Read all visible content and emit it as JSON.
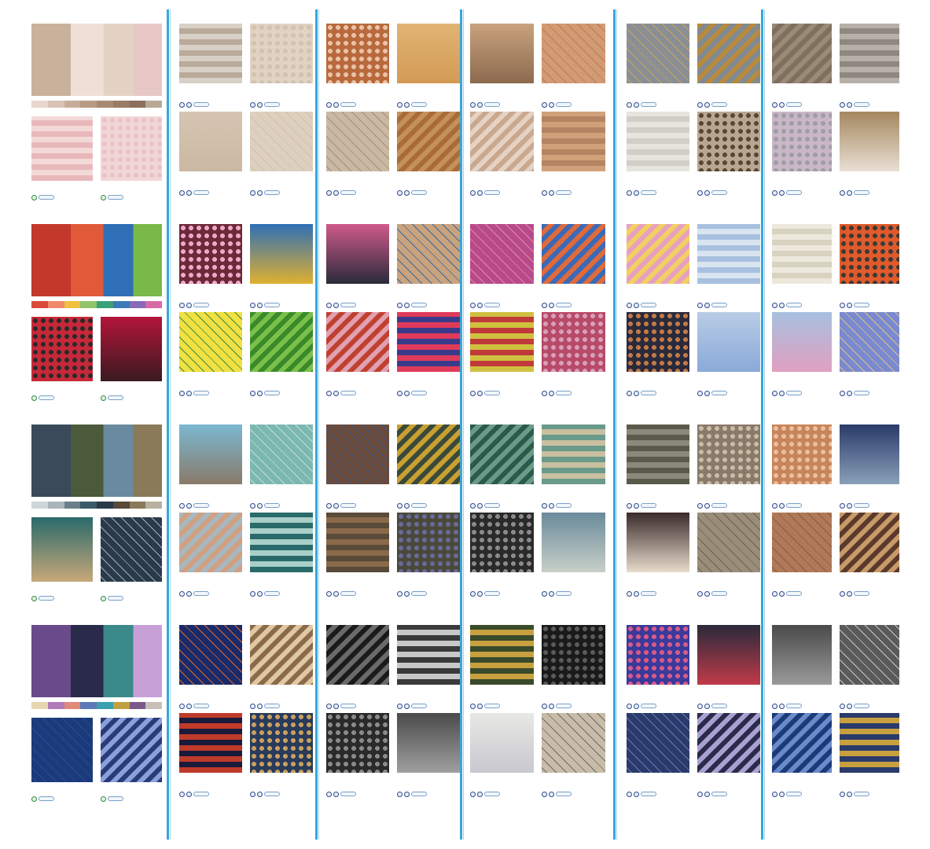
{
  "rows": [
    {
      "palette": [
        "#e8d7cc",
        "#d9c3b5",
        "#c7ad99",
        "#b89a84",
        "#a88a72",
        "#9a7c66",
        "#8d6f5b",
        "#b8a896"
      ],
      "cards": [
        {
          "a": [
            "#c9b29b",
            "#e4d3c4"
          ],
          "b": [
            "#f0dfd6",
            "#e7c8c6"
          ],
          "c": [
            "#e9b8bb",
            "#f3d9d8"
          ],
          "d": [
            "#f1d6d6",
            "#e8c2c4"
          ]
        },
        {
          "a": [
            "#d8d0c7",
            "#b9aa9a"
          ],
          "b": [
            "#e0d3c3",
            "#d2c2ae"
          ],
          "c": [
            "#d5c5b2",
            "#cbb8a3"
          ],
          "d": [
            "#ded0bf",
            "#cfbfab"
          ]
        },
        {
          "a": [
            "#b96a3d",
            "#e8c4a6"
          ],
          "b": [
            "#e1b472",
            "#d39a56"
          ],
          "c": [
            "#c9b8a3",
            "#a68e72"
          ],
          "d": [
            "#c4915a",
            "#a96c39"
          ]
        },
        {
          "a": [
            "#c9a27e",
            "#8c6a4e"
          ],
          "b": [
            "#d39b73",
            "#b87a55"
          ],
          "c": [
            "#c9a890",
            "#e6d2c2"
          ],
          "d": [
            "#d1a07a",
            "#b48462"
          ]
        },
        {
          "a": [
            "#8a8f95",
            "#c9a45a"
          ],
          "b": [
            "#b88a3c",
            "#7f8a94"
          ],
          "c": [
            "#e5e4dd",
            "#cfcfc7"
          ],
          "d": [
            "#b9a690",
            "#5a4636"
          ]
        },
        {
          "a": [
            "#9a8a78",
            "#7f6f5e"
          ],
          "b": [
            "#b7b0a8",
            "#8f8880"
          ],
          "c": [
            "#c9b7c6",
            "#9e9da8"
          ],
          "d": [
            "#a5875f",
            "#e8e0d4"
          ]
        }
      ]
    },
    {
      "palette": [
        "#d94a3a",
        "#f08a6a",
        "#f0c040",
        "#8fc46a",
        "#3aa07a",
        "#3a7ab8",
        "#8a6ab8",
        "#d86aa8"
      ],
      "cards": [
        {
          "a": [
            "#c2392b",
            "#2f6fb5"
          ],
          "b": [
            "#e05a3a",
            "#7ab84a"
          ],
          "c": [
            "#c7283a",
            "#2a2a2a"
          ],
          "d": [
            "#b3153a",
            "#3a1a20"
          ]
        },
        {
          "a": [
            "#6b2a3a",
            "#f0a8c8"
          ],
          "b": [
            "#2f6fb5",
            "#e0b030"
          ],
          "c": [
            "#f0e040",
            "#3a8a4a"
          ],
          "d": [
            "#3a8a2a",
            "#7ac04a"
          ]
        },
        {
          "a": [
            "#d05a8a",
            "#2a2a3a"
          ],
          "b": [
            "#c9a27e",
            "#3a6a9a"
          ],
          "c": [
            "#c04030",
            "#e0a0b0"
          ],
          "d": [
            "#e03a5a",
            "#3a3a8a"
          ]
        },
        {
          "a": [
            "#b84a8a",
            "#e08ab0"
          ],
          "b": [
            "#3a6ab8",
            "#e06a3a"
          ],
          "c": [
            "#d0c040",
            "#c03a3a"
          ],
          "d": [
            "#b84a6a",
            "#d8a0b8"
          ]
        },
        {
          "a": [
            "#e8a0c0",
            "#f0d060"
          ],
          "b": [
            "#a8c0e0",
            "#d8e4f0"
          ],
          "c": [
            "#2a2a3a",
            "#c07a4a"
          ],
          "d": [
            "#b8cce6",
            "#8aaad8"
          ]
        },
        {
          "a": [
            "#ece8dc",
            "#d8d2c0"
          ],
          "b": [
            "#e05a2a",
            "#3a3a3a"
          ],
          "c": [
            "#a8c0e0",
            "#e0a0c0"
          ],
          "d": [
            "#7a8ad0",
            "#e0c080"
          ]
        }
      ]
    },
    {
      "palette": [
        "#cfd6da",
        "#a9b4bb",
        "#6a7f8a",
        "#3a5a6a",
        "#2a3a4a",
        "#5a4a3a",
        "#8a7a5a",
        "#b8b0a0"
      ],
      "cards": [
        {
          "a": [
            "#3a4a5a",
            "#6a8aa0"
          ],
          "b": [
            "#4a5a3a",
            "#8a7a5a"
          ],
          "c": [
            "#2a6a6a",
            "#c8a87a"
          ],
          "d": [
            "#2a3a4a",
            "#9ab0b8"
          ]
        },
        {
          "a": [
            "#7ab8d0",
            "#8a7a6a"
          ],
          "b": [
            "#7ab8b0",
            "#c8dcd6"
          ],
          "c": [
            "#a8b8c0",
            "#d0a080"
          ],
          "d": [
            "#2a6a6a",
            "#a8d0c8"
          ]
        },
        {
          "a": [
            "#6a4a3a",
            "#3a5a8a"
          ],
          "b": [
            "#c9a030",
            "#3a4a3a"
          ],
          "c": [
            "#5a4a3a",
            "#8a6a4a"
          ],
          "d": [
            "#4a4a3a",
            "#6a6a9a"
          ]
        },
        {
          "a": [
            "#2a5a4a",
            "#6a9a8a"
          ],
          "b": [
            "#6a9a8a",
            "#c8c0a0"
          ],
          "c": [
            "#2a2a2a",
            "#8a8a8a"
          ],
          "d": [
            "#6a8a9a",
            "#c8d0c8"
          ]
        },
        {
          "a": [
            "#5a5a4a",
            "#8a8a7a"
          ],
          "b": [
            "#8a7a6a",
            "#c8bca8"
          ],
          "c": [
            "#3a2a2a",
            "#e8dccc"
          ],
          "d": [
            "#9a8e7a",
            "#6a6050"
          ]
        },
        {
          "a": [
            "#c8845a",
            "#e8c0a0"
          ],
          "b": [
            "#2a3a6a",
            "#8aa0b8"
          ],
          "c": [
            "#b07a5a",
            "#8a5a3a"
          ],
          "d": [
            "#c89a6a",
            "#5a3a2a"
          ]
        }
      ]
    },
    {
      "palette": [
        "#e8d6b0",
        "#b07ab8",
        "#e08a7a",
        "#5a7ab8",
        "#3aa0b0",
        "#c0a040",
        "#7a5a8a",
        "#c8c0b8"
      ],
      "cards": [
        {
          "a": [
            "#6a4a8a",
            "#3a8a8a"
          ],
          "b": [
            "#2a2a4a",
            "#c8a0d8"
          ],
          "c": [
            "#1a3a7a",
            "#2a4a9a"
          ],
          "d": [
            "#2a3a7a",
            "#8aa0d8"
          ]
        },
        {
          "a": [
            "#1a2a6a",
            "#e06a2a"
          ],
          "b": [
            "#8a6a4a",
            "#e0c8a0"
          ],
          "c": [
            "#c03a2a",
            "#1a1a3a"
          ],
          "d": [
            "#2a3a5a",
            "#c8a060"
          ]
        },
        {
          "a": [
            "#1a1a1a",
            "#6a6a6a"
          ],
          "b": [
            "#3a3a3a",
            "#c8c8c8"
          ],
          "c": [
            "#2a2a2a",
            "#8a8a8a"
          ],
          "d": [
            "#4a4a4a",
            "#a0a0a0"
          ]
        },
        {
          "a": [
            "#3a4a2a",
            "#c8a040"
          ],
          "b": [
            "#1a1a1a",
            "#5a5a5a"
          ],
          "c": [
            "#e8e8e4",
            "#c8c8d0"
          ],
          "d": [
            "#c8bca8",
            "#6a6a6a"
          ]
        },
        {
          "a": [
            "#3a3a9a",
            "#d85a8a"
          ],
          "b": [
            "#2a2a3a",
            "#c03a4a"
          ],
          "c": [
            "#2a3a6a",
            "#6a7ab8"
          ],
          "d": [
            "#2a2a4a",
            "#a8a0d0"
          ]
        },
        {
          "a": [
            "#4a4a4a",
            "#9a9a9a"
          ],
          "b": [
            "#5a5a5a",
            "#c8c8c8"
          ],
          "c": [
            "#1a3a7a",
            "#6a8ac8"
          ],
          "d": [
            "#2a3a6a",
            "#c8a040"
          ]
        }
      ]
    }
  ]
}
